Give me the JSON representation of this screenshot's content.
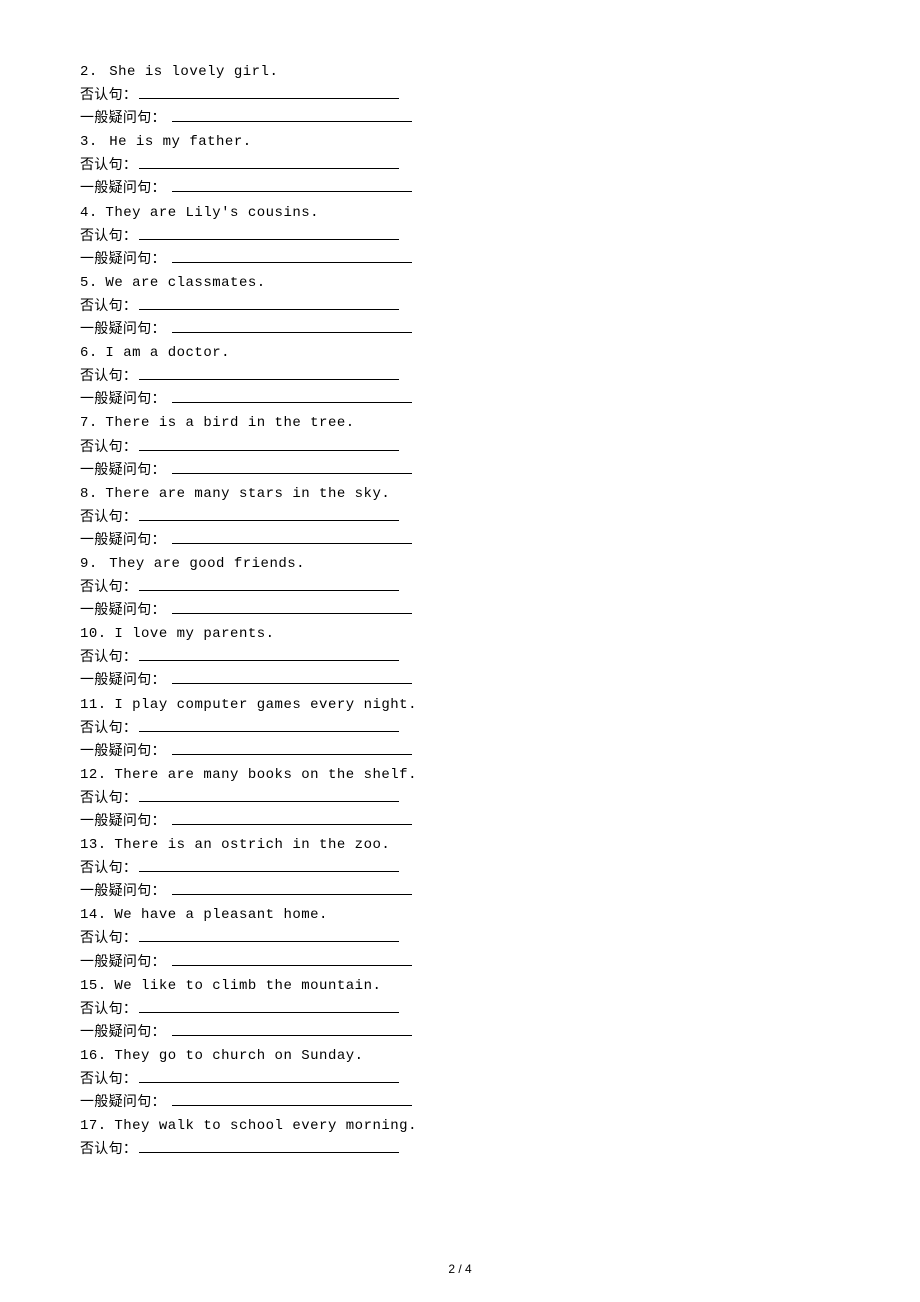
{
  "labels": {
    "neg": "否认句：",
    "question": "一般疑问句："
  },
  "footer": "2 / 4",
  "items": [
    {
      "num": "2.",
      "sp": "   ",
      "text": "She is lovely girl.",
      "full": true
    },
    {
      "num": "3.",
      "sp": "   ",
      "text": "He is my father.",
      "full": true
    },
    {
      "num": "4.",
      "sp": "  ",
      "text": "They are Lily's cousins.",
      "full": true
    },
    {
      "num": "5.",
      "sp": "  ",
      "text": "We are classmates.",
      "full": true
    },
    {
      "num": "6.",
      "sp": "  ",
      "text": "I am a doctor.",
      "full": true
    },
    {
      "num": "7.",
      "sp": "  ",
      "text": "There is a bird in the tree.",
      "full": true
    },
    {
      "num": "8.",
      "sp": "  ",
      "text": "There are many stars in the sky.",
      "full": true
    },
    {
      "num": " 9.",
      "sp": "   ",
      "text": "They are good friends.",
      "full": true
    },
    {
      "num": "10.",
      "sp": "  ",
      "text": "I love my parents.",
      "full": true
    },
    {
      "num": "11.",
      "sp": "  ",
      "text": "I play computer games every night.",
      "full": true
    },
    {
      "num": " 12.",
      "sp": "  ",
      "text": "There are many books on the shelf.",
      "full": true
    },
    {
      "num": "13.",
      "sp": "  ",
      "text": "There is an ostrich in the zoo.",
      "full": true
    },
    {
      "num": "14.",
      "sp": "  ",
      "text": "We have a pleasant home.",
      "full": true
    },
    {
      "num": "15.",
      "sp": "  ",
      "text": "We like to climb the mountain.",
      "full": true
    },
    {
      "num": "16.",
      "sp": "  ",
      "text": "They go to church on Sunday.",
      "full": true
    },
    {
      "num": "17.",
      "sp": "  ",
      "text": "They walk to school every morning.",
      "full": false
    }
  ]
}
